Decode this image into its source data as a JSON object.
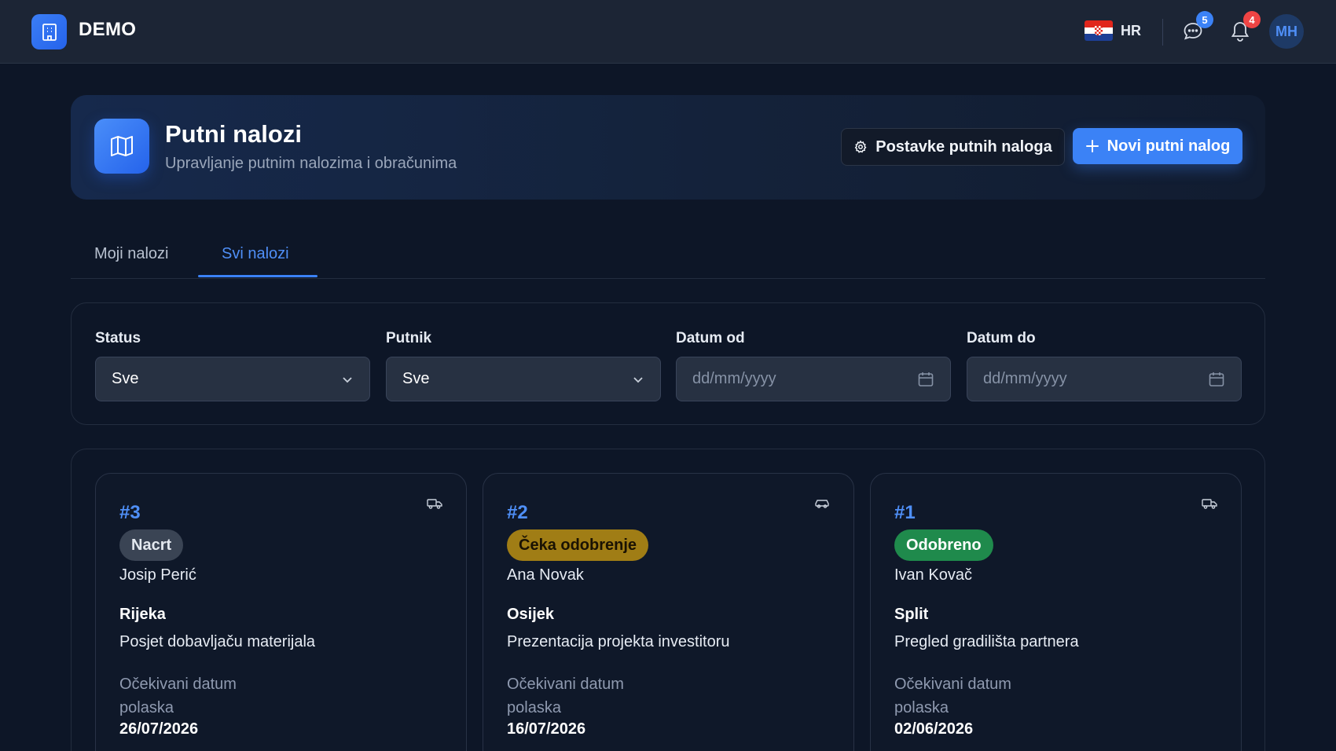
{
  "topbar": {
    "brand": "DEMO",
    "language_code": "HR",
    "messages_count": "5",
    "notifications_count": "4",
    "avatar_initials": "MH"
  },
  "header": {
    "title": "Putni nalozi",
    "subtitle": "Upravljanje putnim nalozima i obračunima",
    "settings_label": "Postavke putnih naloga",
    "new_label": "Novi putni nalog"
  },
  "tabs": [
    {
      "label": "Moji nalozi",
      "active": false
    },
    {
      "label": "Svi nalozi",
      "active": true
    }
  ],
  "filters": {
    "status_label": "Status",
    "status_value": "Sve",
    "traveler_label": "Putnik",
    "traveler_value": "Sve",
    "date_from_label": "Datum od",
    "date_from_placeholder": "dd/mm/yyyy",
    "date_to_label": "Datum do",
    "date_to_placeholder": "dd/mm/yyyy"
  },
  "orders": [
    {
      "number": "#3",
      "status": "Nacrt",
      "status_type": "draft",
      "person": "Josip Perić",
      "city": "Rijeka",
      "purpose": "Posjet dobavljaču materijala",
      "date_label": "Očekivani datum polaska",
      "date": "26/07/2026",
      "vehicle_icon": "truck-icon"
    },
    {
      "number": "#2",
      "status": "Čeka odobrenje",
      "status_type": "pending",
      "person": "Ana Novak",
      "city": "Osijek",
      "purpose": "Prezentacija projekta investitoru",
      "date_label": "Očekivani datum polaska",
      "date": "16/07/2026",
      "vehicle_icon": "car-icon"
    },
    {
      "number": "#1",
      "status": "Odobreno",
      "status_type": "approved",
      "person": "Ivan Kovač",
      "city": "Split",
      "purpose": "Pregled gradilišta partnera",
      "date_label": "Očekivani datum polaska",
      "date": "02/06/2026",
      "vehicle_icon": "truck-icon"
    }
  ],
  "colors": {
    "accent": "#3b82f6",
    "background": "#0d1627",
    "draft": "#3a4454",
    "pending": "#a07d15",
    "approved": "#1f8a4c"
  }
}
